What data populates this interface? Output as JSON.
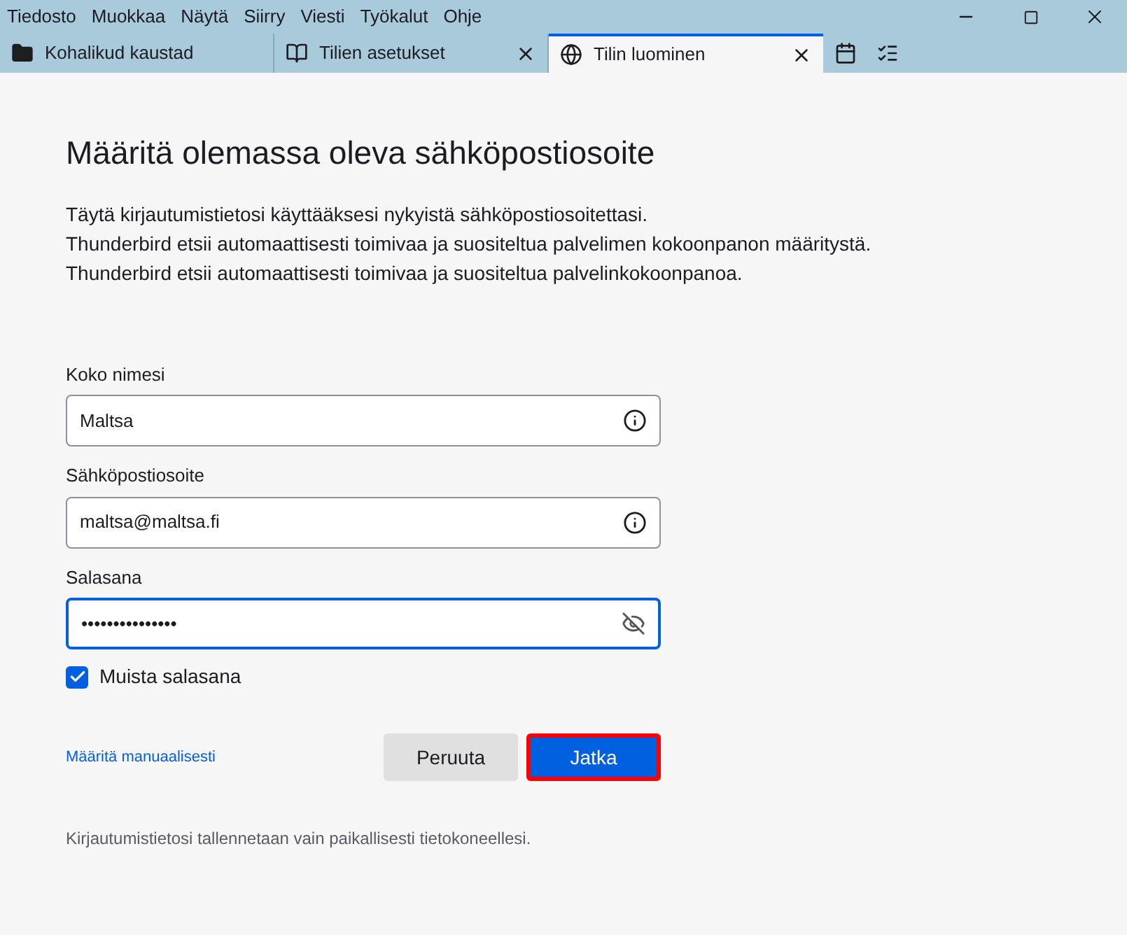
{
  "menu": [
    "Tiedosto",
    "Muokkaa",
    "Näytä",
    "Siirry",
    "Viesti",
    "Työkalut",
    "Ohje"
  ],
  "tabs": [
    {
      "label": "Kohalikud kaustad",
      "kind": "folder",
      "closable": false,
      "selected": false
    },
    {
      "label": "Tilien asetukset",
      "kind": "book",
      "closable": true,
      "selected": false
    },
    {
      "label": "Tilin luominen",
      "kind": "globe",
      "closable": true,
      "selected": true
    }
  ],
  "heading": "Määritä olemassa oleva sähköpostiosoite",
  "intro": [
    "Täytä kirjautumistietosi käyttääksesi nykyistä sähköpostiosoitettasi.",
    "Thunderbird etsii automaattisesti toimivaa ja suositeltua palvelimen kokoonpanon määritystä.",
    "Thunderbird etsii automaattisesti toimivaa ja suositeltua palvelinkokoonpanoa."
  ],
  "fields": [
    {
      "label": "Koko nimesi",
      "value": "Maltsa",
      "kind": "info",
      "focused": false
    },
    {
      "label": "Sähköpostiosoite",
      "value": "maltsa@maltsa.fi",
      "kind": "info",
      "focused": false
    },
    {
      "label": "Salasana",
      "value": "•••••••••••••••",
      "kind": "password",
      "focused": true
    }
  ],
  "remember": {
    "label": "Muista salasana",
    "checked": true
  },
  "manual_link": "Määritä manuaalisesti",
  "buttons": [
    {
      "label": "Peruuta",
      "kind": "secondary",
      "highlighted": false
    },
    {
      "label": "Jatka",
      "kind": "primary",
      "highlighted": true
    }
  ],
  "footer": "Kirjautumistietosi tallennetaan vain paikallisesti tietokoneellesi."
}
